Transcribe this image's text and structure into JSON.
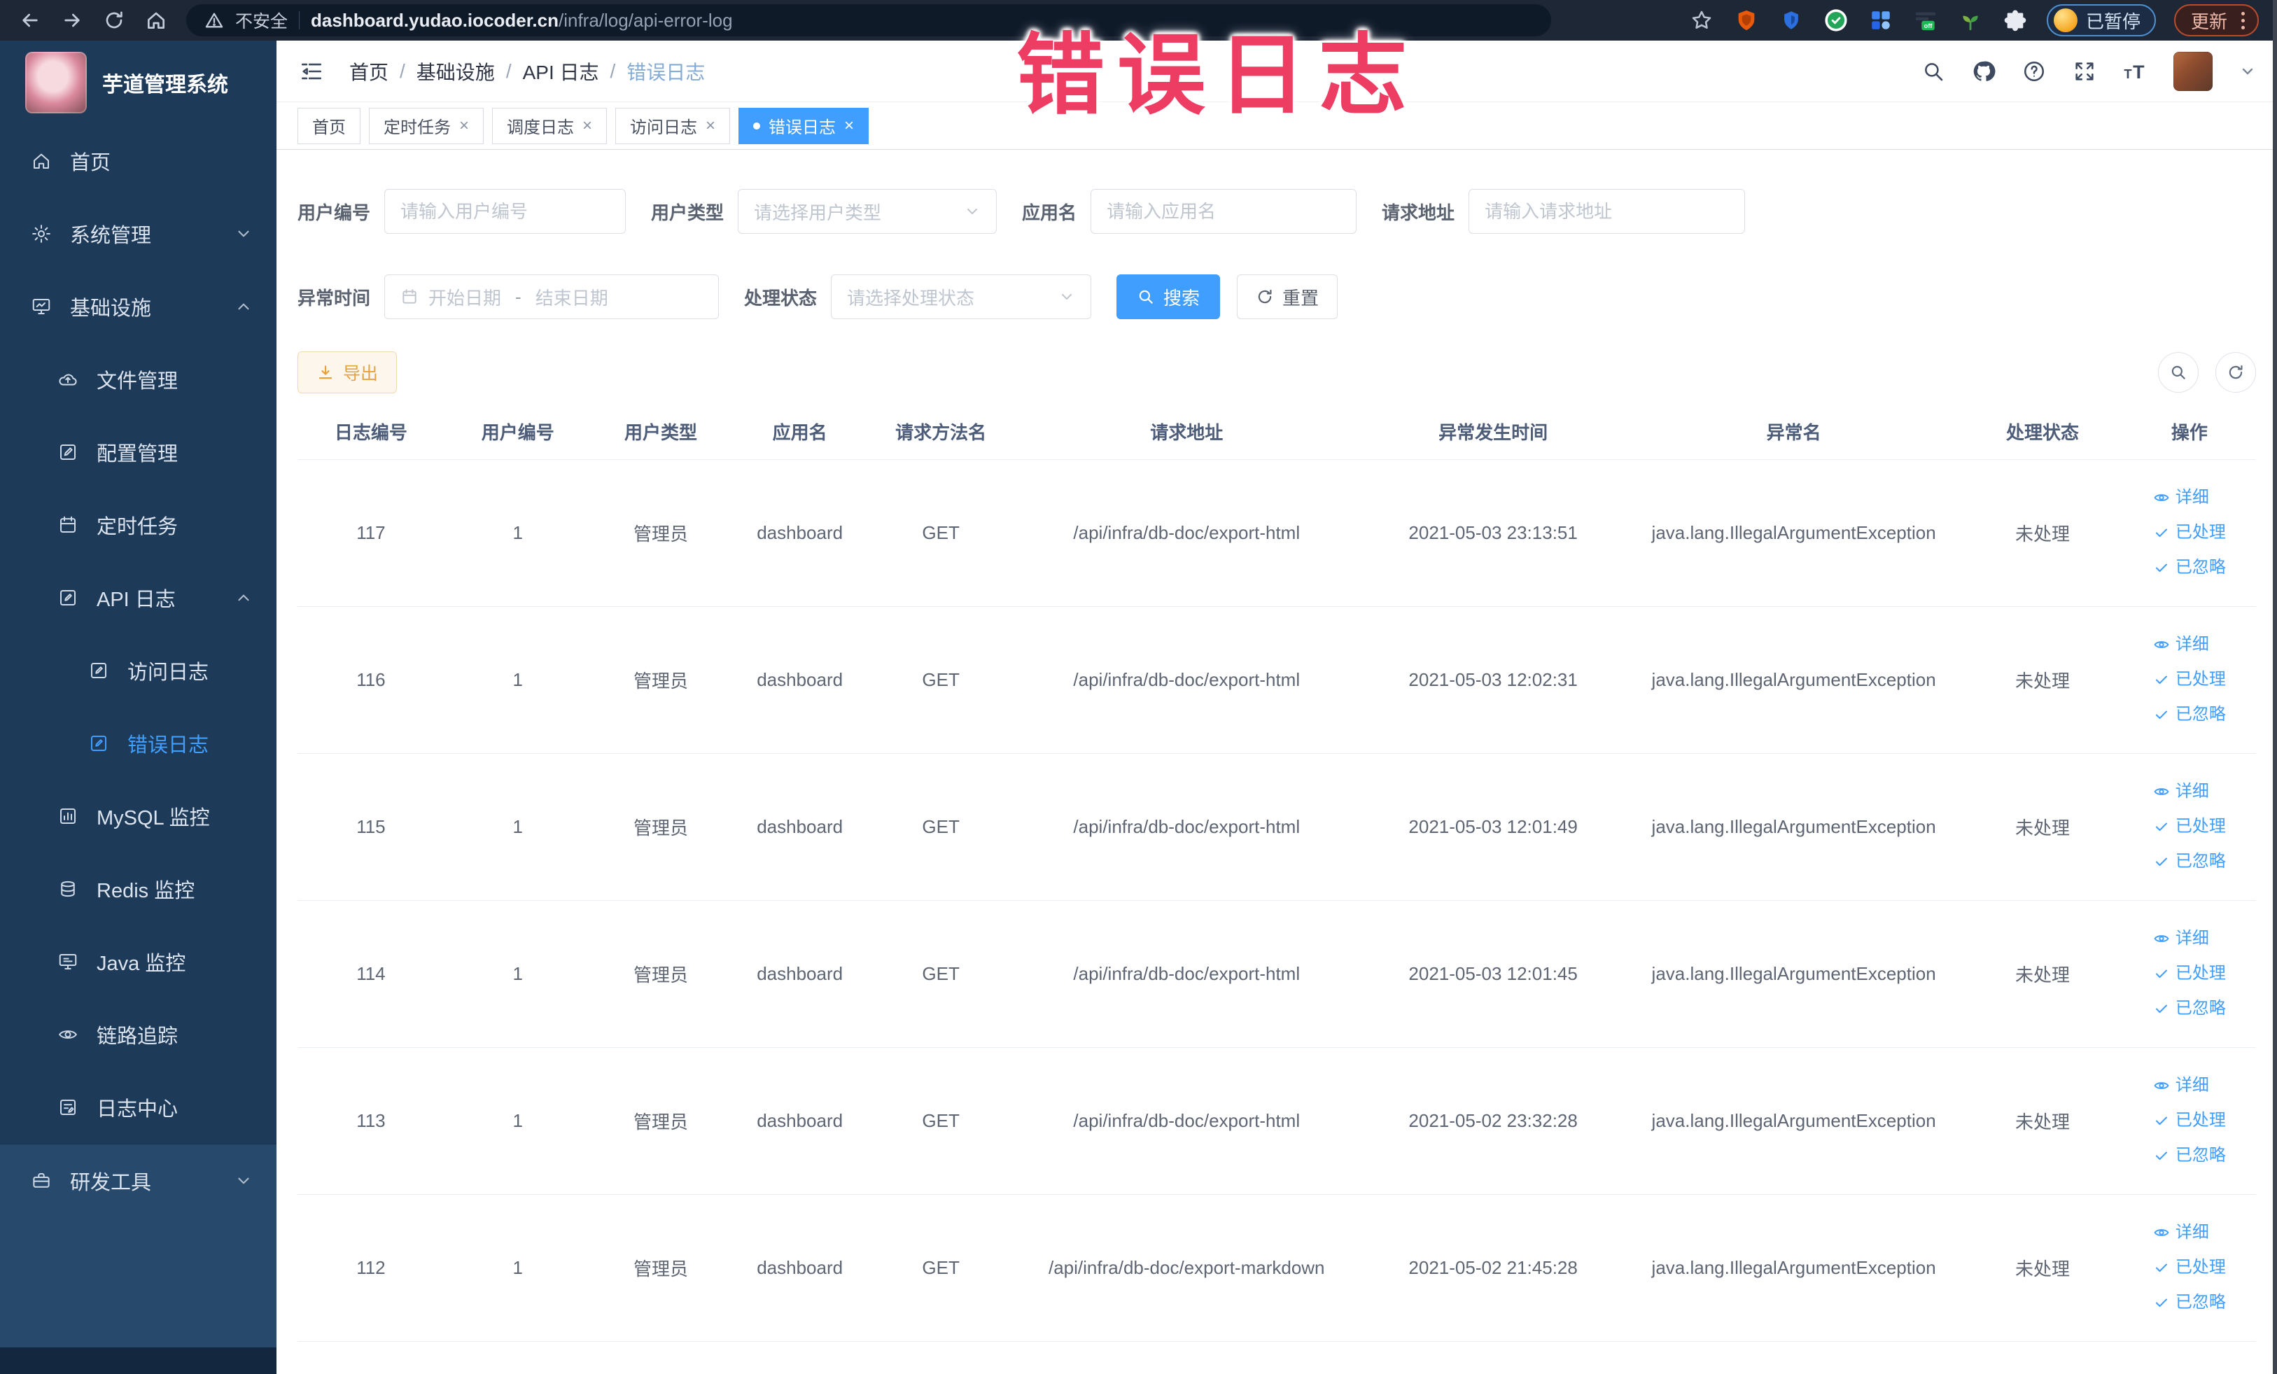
{
  "colors": {
    "primary": "#409eff",
    "link_blue": "#409eff",
    "warning_text": "#e6a23c",
    "warning_bg": "#fdf6ec",
    "warning_border": "#f5dab1",
    "overlay_pink": "#ee3d63",
    "sidebar_bg": "#1e3a59",
    "browser_bar_bg": "#1d2736",
    "active_tab_bg": "#409eff"
  },
  "overlay_title": "错误日志",
  "icons": {
    "close": "×",
    "breadcrumb_sep": "/"
  },
  "browser": {
    "security_label": "不安全",
    "url_host": "dashboard.yudao.iocoder.cn",
    "url_path": "/infra/log/api-error-log",
    "paused_label": "已暂停",
    "update_label": "更新",
    "extension_icons": [
      "bookmark-star-icon",
      "shield-orange-extension-icon",
      "shield-blue-extension-icon",
      "green-circle-extension-icon",
      "grid-extension-icon",
      "off-toggle-extension-icon",
      "sprout-extension-icon",
      "puzzle-extensions-icon"
    ]
  },
  "sidebar": {
    "app_title": "芋道管理系统",
    "items": [
      {
        "label": "首页"
      },
      {
        "label": "系统管理"
      },
      {
        "label": "基础设施"
      },
      {
        "label": "文件管理"
      },
      {
        "label": "配置管理"
      },
      {
        "label": "定时任务"
      },
      {
        "label": "API 日志"
      },
      {
        "label": "访问日志"
      },
      {
        "label": "错误日志"
      },
      {
        "label": "MySQL 监控"
      },
      {
        "label": "Redis 监控"
      },
      {
        "label": "Java 监控"
      },
      {
        "label": "链路追踪"
      },
      {
        "label": "日志中心"
      },
      {
        "label": "研发工具"
      }
    ]
  },
  "breadcrumb": {
    "sep": "/",
    "items": [
      "首页",
      "基础设施",
      "API 日志",
      "错误日志"
    ]
  },
  "tabs": [
    {
      "label": "首页"
    },
    {
      "label": "定时任务"
    },
    {
      "label": "调度日志"
    },
    {
      "label": "访问日志"
    },
    {
      "label": "错误日志"
    }
  ],
  "filters": {
    "user_id": {
      "label": "用户编号",
      "placeholder": "请输入用户编号"
    },
    "user_type": {
      "label": "用户类型",
      "placeholder": "请选择用户类型"
    },
    "app_name": {
      "label": "应用名",
      "placeholder": "请输入应用名"
    },
    "request_url": {
      "label": "请求地址",
      "placeholder": "请输入请求地址"
    },
    "exception_time": {
      "label": "异常时间",
      "start_placeholder": "开始日期",
      "separator": "-",
      "end_placeholder": "结束日期"
    },
    "process_status": {
      "label": "处理状态",
      "placeholder": "请选择处理状态"
    },
    "search_label": "搜索",
    "reset_label": "重置"
  },
  "toolbar": {
    "export_label": "导出"
  },
  "table": {
    "columns": [
      "日志编号",
      "用户编号",
      "用户类型",
      "应用名",
      "请求方法名",
      "请求地址",
      "异常发生时间",
      "异常名",
      "处理状态",
      "操作"
    ],
    "actions": {
      "detail": "详细",
      "processed": "已处理",
      "ignored": "已忽略"
    },
    "rows": [
      {
        "id": "117",
        "user_id": "1",
        "user_type": "管理员",
        "app": "dashboard",
        "method": "GET",
        "url": "/api/infra/db-doc/export-html",
        "time": "2021-05-03 23:13:51",
        "exception": "java.lang.IllegalArgumentException",
        "status": "未处理"
      },
      {
        "id": "116",
        "user_id": "1",
        "user_type": "管理员",
        "app": "dashboard",
        "method": "GET",
        "url": "/api/infra/db-doc/export-html",
        "time": "2021-05-03 12:02:31",
        "exception": "java.lang.IllegalArgumentException",
        "status": "未处理"
      },
      {
        "id": "115",
        "user_id": "1",
        "user_type": "管理员",
        "app": "dashboard",
        "method": "GET",
        "url": "/api/infra/db-doc/export-html",
        "time": "2021-05-03 12:01:49",
        "exception": "java.lang.IllegalArgumentException",
        "status": "未处理"
      },
      {
        "id": "114",
        "user_id": "1",
        "user_type": "管理员",
        "app": "dashboard",
        "method": "GET",
        "url": "/api/infra/db-doc/export-html",
        "time": "2021-05-03 12:01:45",
        "exception": "java.lang.IllegalArgumentException",
        "status": "未处理"
      },
      {
        "id": "113",
        "user_id": "1",
        "user_type": "管理员",
        "app": "dashboard",
        "method": "GET",
        "url": "/api/infra/db-doc/export-html",
        "time": "2021-05-02 23:32:28",
        "exception": "java.lang.IllegalArgumentException",
        "status": "未处理"
      },
      {
        "id": "112",
        "user_id": "1",
        "user_type": "管理员",
        "app": "dashboard",
        "method": "GET",
        "url": "/api/infra/db-doc/export-markdown",
        "time": "2021-05-02 21:45:28",
        "exception": "java.lang.IllegalArgumentException",
        "status": "未处理"
      }
    ]
  }
}
